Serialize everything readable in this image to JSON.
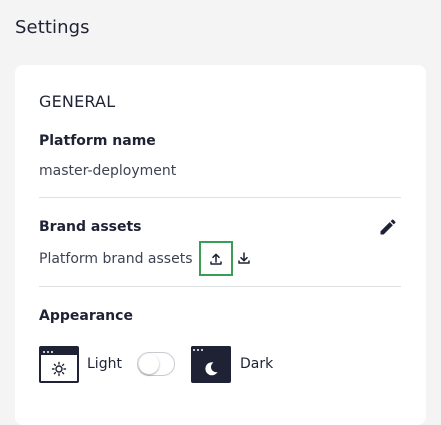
{
  "page": {
    "title": "Settings"
  },
  "general": {
    "heading": "GENERAL",
    "platform_name": {
      "label": "Platform name",
      "value": "master-deployment"
    },
    "brand_assets": {
      "label": "Brand assets",
      "value": "Platform brand assets",
      "icons": [
        "edit-pencil-icon",
        "upload-icon",
        "download-icon"
      ]
    },
    "appearance": {
      "label": "Appearance",
      "light_label": "Light",
      "dark_label": "Dark",
      "toggle_on": false,
      "icons": [
        "sun-icon",
        "moon-icon"
      ]
    }
  },
  "colors": {
    "text_primary": "#1e2234",
    "focus_border": "#3a9e57",
    "background": "#f4f4f5",
    "card": "#ffffff"
  }
}
